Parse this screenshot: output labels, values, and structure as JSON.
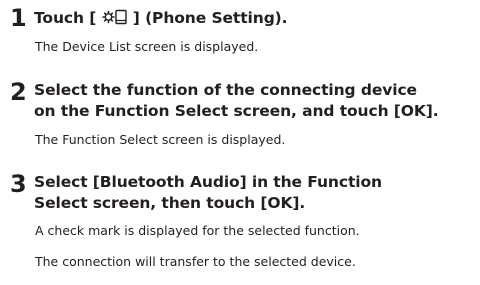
{
  "steps": [
    {
      "number": "1",
      "title_before_icon": "Touch [ ",
      "icon": "gear-phone-icon",
      "title_after_icon": " ] (Phone Setting).",
      "descriptions": [
        "The Device List screen is displayed."
      ]
    },
    {
      "number": "2",
      "title_lines": [
        "Select the function of the connecting device",
        "on the Function Select screen, and touch [OK]."
      ],
      "descriptions": [
        "The Function Select screen is displayed."
      ]
    },
    {
      "number": "3",
      "title_lines": [
        "Select [Bluetooth Audio] in the Function",
        "Select screen, then touch [OK]."
      ],
      "descriptions": [
        "A check mark is displayed for the selected function.",
        "The connection will transfer to the selected device."
      ]
    }
  ]
}
